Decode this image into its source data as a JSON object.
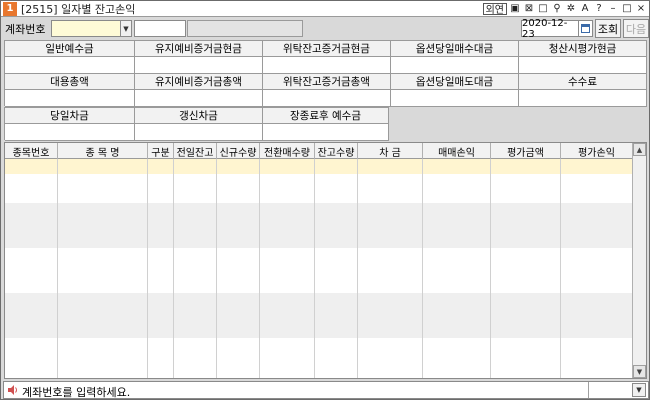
{
  "window": {
    "icon_label": "1",
    "title": "[2515] 일자별 잔고손익",
    "tools": [
      "외연",
      "▣",
      "⊠",
      "□",
      "⚲",
      "✲",
      "A",
      "?",
      "–",
      "□",
      "×"
    ]
  },
  "account": {
    "label": "계좌번호",
    "number": "",
    "name": "",
    "date": "2020-12-23",
    "query_label": "조회",
    "next_label": "다음"
  },
  "summary_rows": [
    [
      {
        "label": "일반예수금",
        "value": ""
      },
      {
        "label": "유지예비증거금현금",
        "value": ""
      },
      {
        "label": "위탁잔고증거금현금",
        "value": ""
      },
      {
        "label": "옵션당일매수대금",
        "value": ""
      },
      {
        "label": "청산시평가현금",
        "value": ""
      }
    ],
    [
      {
        "label": "대용총액",
        "value": ""
      },
      {
        "label": "유지예비증거금총액",
        "value": ""
      },
      {
        "label": "위탁잔고증거금총액",
        "value": ""
      },
      {
        "label": "옵션당일매도대금",
        "value": ""
      },
      {
        "label": "수수료",
        "value": ""
      }
    ],
    [
      {
        "label": "당일차금",
        "value": ""
      },
      {
        "label": "갱신차금",
        "value": ""
      },
      {
        "label": "장종료후 예수금",
        "value": ""
      }
    ]
  ],
  "table": {
    "headers": [
      "종목번호",
      "종 목 명",
      "구분",
      "전일잔고",
      "신규수량",
      "전환매수량",
      "잔고수량",
      "차   금",
      "매매손익",
      "평가금액",
      "평가손익"
    ],
    "rows": []
  },
  "status": {
    "message": "계좌번호를 입력하세요."
  },
  "colors": {
    "selected_row": "#fff5d0",
    "band_row": "#efefef",
    "window_bg": "#d9d9d9",
    "app_icon": "#e8772e"
  }
}
